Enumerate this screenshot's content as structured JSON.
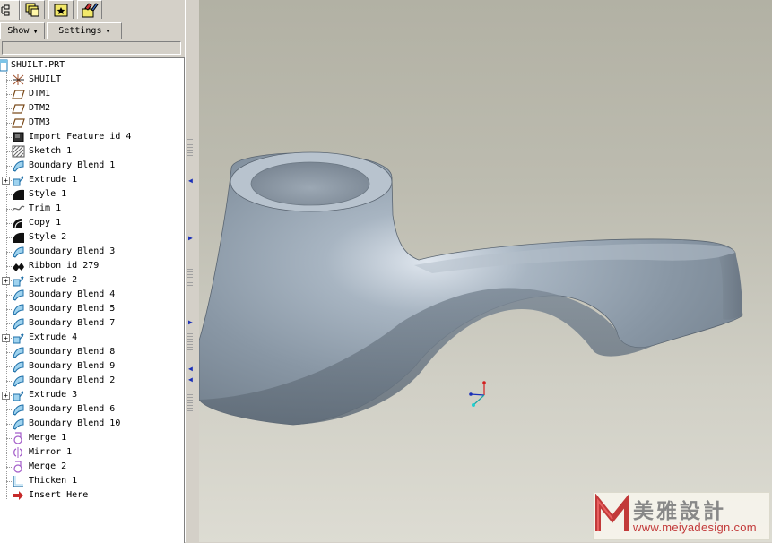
{
  "tabs": [
    {
      "name": "model-tree-tab-icon"
    },
    {
      "name": "layers-tab-icon"
    },
    {
      "name": "favorites-tab-icon"
    },
    {
      "name": "tools-tab-icon"
    }
  ],
  "toolbar": {
    "show_label": "Show",
    "settings_label": "Settings"
  },
  "tree": {
    "root": {
      "label": "SHUILT.PRT",
      "icon": "part-icon"
    },
    "items": [
      {
        "label": "SHUILT",
        "icon": "csys-icon",
        "expandable": false
      },
      {
        "label": "DTM1",
        "icon": "datum-plane-icon",
        "expandable": false
      },
      {
        "label": "DTM2",
        "icon": "datum-plane-icon",
        "expandable": false
      },
      {
        "label": "DTM3",
        "icon": "datum-plane-icon",
        "expandable": false
      },
      {
        "label": "Import Feature id 4",
        "icon": "import-feature-icon",
        "expandable": false
      },
      {
        "label": "Sketch 1",
        "icon": "sketch-icon",
        "expandable": false
      },
      {
        "label": "Boundary Blend 1",
        "icon": "boundary-blend-icon",
        "expandable": false
      },
      {
        "label": "Extrude 1",
        "icon": "extrude-icon",
        "expandable": true
      },
      {
        "label": "Style 1",
        "icon": "style-icon",
        "expandable": false
      },
      {
        "label": "Trim 1",
        "icon": "trim-icon",
        "expandable": false
      },
      {
        "label": "Copy 1",
        "icon": "copy-icon",
        "expandable": false
      },
      {
        "label": "Style 2",
        "icon": "style-icon",
        "expandable": false
      },
      {
        "label": "Boundary Blend 3",
        "icon": "boundary-blend-icon",
        "expandable": false
      },
      {
        "label": "Ribbon id 279",
        "icon": "ribbon-icon",
        "expandable": false
      },
      {
        "label": "Extrude 2",
        "icon": "extrude-icon",
        "expandable": true
      },
      {
        "label": "Boundary Blend 4",
        "icon": "boundary-blend-icon",
        "expandable": false
      },
      {
        "label": "Boundary Blend 5",
        "icon": "boundary-blend-icon",
        "expandable": false
      },
      {
        "label": "Boundary Blend 7",
        "icon": "boundary-blend-icon",
        "expandable": false
      },
      {
        "label": "Extrude 4",
        "icon": "extrude-icon",
        "expandable": true
      },
      {
        "label": "Boundary Blend 8",
        "icon": "boundary-blend-icon",
        "expandable": false
      },
      {
        "label": "Boundary Blend 9",
        "icon": "boundary-blend-icon",
        "expandable": false
      },
      {
        "label": "Boundary Blend 2",
        "icon": "boundary-blend-icon",
        "expandable": false
      },
      {
        "label": "Extrude 3",
        "icon": "extrude-icon",
        "expandable": true
      },
      {
        "label": "Boundary Blend 6",
        "icon": "boundary-blend-icon",
        "expandable": false
      },
      {
        "label": "Boundary Blend 10",
        "icon": "boundary-blend-icon",
        "expandable": false
      },
      {
        "label": "Merge 1",
        "icon": "merge-icon",
        "expandable": false
      },
      {
        "label": "Mirror 1",
        "icon": "mirror-icon",
        "expandable": false
      },
      {
        "label": "Merge 2",
        "icon": "merge-icon",
        "expandable": false
      },
      {
        "label": "Thicken 1",
        "icon": "thicken-icon",
        "expandable": false
      },
      {
        "label": "Insert Here",
        "icon": "insert-here-arrow-icon",
        "expandable": false
      }
    ]
  },
  "viewport": {
    "model": "faucet-spout-model",
    "csys": "coordinate-system-triad-icon"
  },
  "watermark": {
    "logo": "meiya-logo",
    "text": "美雅設計",
    "url": "www.meiyadesign.com"
  },
  "colors": {
    "panel": "#d4d0c8",
    "model_surface": "#8e9aa6",
    "icon_blue": "#2a6fb0",
    "insert_arrow": "#c62a2a"
  }
}
